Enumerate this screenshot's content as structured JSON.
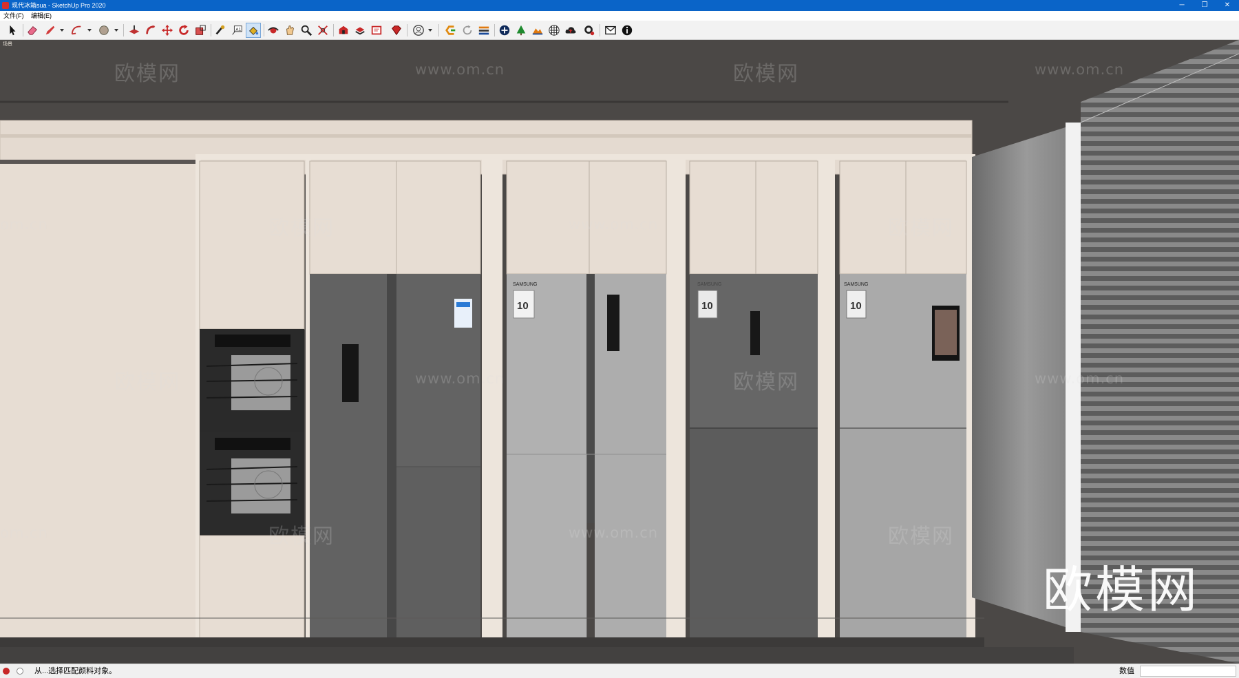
{
  "window": {
    "title": "现代冰箱sua - SketchUp Pro 2020",
    "controls": {
      "minimize": "─",
      "restore": "❐",
      "close": "✕"
    }
  },
  "menu": {
    "items": [
      "文件(F)",
      "编辑(E)"
    ]
  },
  "toolbar": {
    "tools": [
      "select-icon",
      "eraser-icon",
      "pencil-icon",
      "arc-icon",
      "circle-icon",
      "push-pull-icon",
      "follow-me-icon",
      "move-icon",
      "rotate-icon",
      "scale-icon",
      "tape-measure-icon",
      "text-icon",
      "paint-bucket-icon",
      "orbit-icon",
      "pan-icon",
      "zoom-icon",
      "zoom-extents-icon",
      "warehouse-icon",
      "extension-icon",
      "layout-icon",
      "ruby-icon",
      "account-icon",
      "sandbox-icon",
      "refresh-icon",
      "layers-icon",
      "add-icon",
      "tree-icon",
      "terrain-icon",
      "material-icon",
      "cloud-icon",
      "settings-icon",
      "mail-icon",
      "info-icon"
    ]
  },
  "viewport": {
    "scene_label": "场景",
    "watermarks": {
      "brand": "欧模网",
      "url": "www.om.cn",
      "url_partial": "om.cn"
    },
    "appliances": [
      {
        "brand": "",
        "kind": "oven-column"
      },
      {
        "brand": "",
        "kind": "side-by-side"
      },
      {
        "brand": "SAMSUNG",
        "kind": "four-door",
        "badge": "10"
      },
      {
        "brand": "SAMSUNG",
        "kind": "two-door",
        "badge": "10"
      },
      {
        "brand": "SAMSUNG",
        "kind": "two-door-display",
        "badge": "10"
      }
    ]
  },
  "status": {
    "message": "从...选择匹配颜料对象。",
    "value_label": "数值",
    "value": ""
  },
  "colors": {
    "titlebar": "#0a64c8",
    "wall": "#4b4846",
    "cabinet": "#e7ddd3",
    "fridge_dark": "#636363",
    "fridge_light": "#aeaeae"
  }
}
